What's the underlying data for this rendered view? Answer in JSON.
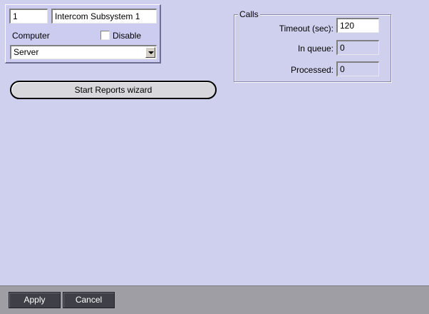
{
  "object": {
    "id_value": "1",
    "name_value": "Intercom Subsystem 1",
    "computer_label": "Computer",
    "disable_label": "Disable",
    "disable_checked": false,
    "computer_selected": "Server"
  },
  "wizard_button_label": "Start Reports wizard",
  "calls": {
    "legend": "Calls",
    "timeout_label": "Timeout (sec):",
    "timeout_value": "120",
    "in_queue_label": "In queue:",
    "in_queue_value": "0",
    "processed_label": "Processed:",
    "processed_value": "0"
  },
  "footer": {
    "apply_label": "Apply",
    "cancel_label": "Cancel"
  },
  "colors": {
    "background": "#cfcfee",
    "footer": "#9e9ea4",
    "footer_button": "#3f3f47"
  }
}
